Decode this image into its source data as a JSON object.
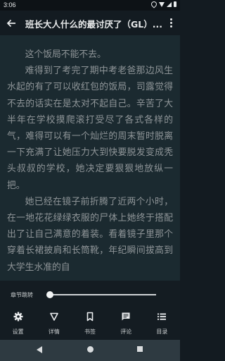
{
  "status": {
    "time": "3:06"
  },
  "app_bar": {
    "title": "班长大人什么的最讨厌了（GL）..."
  },
  "reader": {
    "paragraphs": [
      "这个饭局不能不去。",
      "难得到了考完了期中考老爸那边风生水起的有了可以收红包的饭局，司露觉得不去的话实在是太对不起自己。辛苦了大半年在学校摸爬滚打受尽了各式各样的气，难得可以有一个灿烂的周末暂时脱离一下充满了让她压力大到快要脱发变成秃头叔叔的学校，她决定要狠狠地放纵一把。",
      "她已经在镜子前折腾了近两个小时，在一地花花绿绿衣服的尸体上她终于搭配出了让自己满意的着装。看着镜子里那个穿着长裙披肩和长筒靴，年纪瞬间拔高到大学生水准的自"
    ]
  },
  "controls": {
    "chapter_jump_label": "章节跳转",
    "chapter_progress": 0,
    "menu": [
      {
        "label": "设置",
        "icon": "gear-icon"
      },
      {
        "label": "详情",
        "icon": "triangle-down-icon"
      },
      {
        "label": "书签",
        "icon": "bookmark-icon"
      },
      {
        "label": "评论",
        "icon": "comment-icon"
      },
      {
        "label": "目录",
        "icon": "list-icon"
      }
    ]
  }
}
